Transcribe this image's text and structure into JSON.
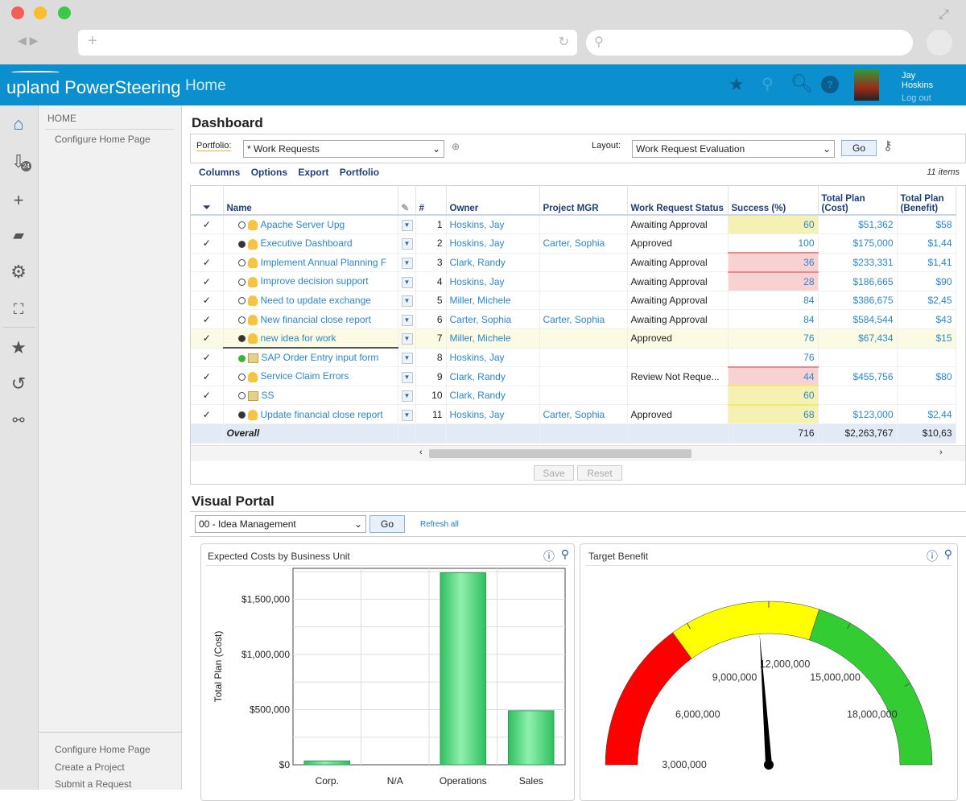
{
  "header": {
    "logo": "upland PowerSteering",
    "page": "Home",
    "user_first": "Jay",
    "user_last": "Hoskins",
    "logout": "Log out"
  },
  "colors": {
    "header": "#0b8fcf",
    "link": "#2a87cf",
    "gauge_red": "#ff0000",
    "gauge_yellow": "#ffff00",
    "gauge_green": "#33cc33",
    "bar": "#3fcf6f"
  },
  "rail": [
    {
      "icon": "home-icon"
    },
    {
      "icon": "inbox-download-icon",
      "badge": "24"
    },
    {
      "icon": "plus-icon"
    },
    {
      "icon": "folder-search-icon"
    },
    {
      "icon": "gear-icon"
    },
    {
      "icon": "chart-icon"
    },
    {
      "icon": "star-icon"
    },
    {
      "icon": "history-icon"
    },
    {
      "icon": "link-icon"
    }
  ],
  "sidebar": {
    "section": "HOME",
    "items": [
      "Configure Home Page"
    ],
    "bottom": [
      "Configure Home Page",
      "Create a Project",
      "Submit a Request"
    ]
  },
  "dashboard": {
    "title": "Dashboard",
    "portfolio_label": "Portfolio:",
    "portfolio_value": "* Work Requests",
    "layout_label": "Layout:",
    "layout_value": "Work Request Evaluation",
    "go": "Go",
    "links": [
      "Columns",
      "Options",
      "Export",
      "Portfolio"
    ],
    "count": "11 items",
    "columns": [
      "Name",
      "#",
      "Owner",
      "Project MGR",
      "Work Request Status",
      "Success (%)",
      "Total Plan (Cost)",
      "Total Plan (Benefit)"
    ],
    "rows": [
      {
        "check": "✓",
        "state": "open",
        "icon": "bulb",
        "name": "Apache Server Upg",
        "num": "1",
        "owner": "Hoskins, Jay",
        "mgr": "",
        "status": "Awaiting Approval",
        "success": "60",
        "flag": "yel",
        "cost": "$51,362",
        "benefit": "$58"
      },
      {
        "check": "✓",
        "state": "filled",
        "icon": "bulb",
        "name": "Executive Dashboard",
        "num": "2",
        "owner": "Hoskins, Jay",
        "mgr": "Carter, Sophia",
        "status": "Approved",
        "success": "100",
        "flag": "",
        "cost": "$175,000",
        "benefit": "$1,44"
      },
      {
        "check": "✓",
        "state": "open",
        "icon": "bulb",
        "name": "Implement Annual Planning F",
        "num": "3",
        "owner": "Clark, Randy",
        "mgr": "",
        "status": "Awaiting Approval",
        "success": "36",
        "flag": "red",
        "cost": "$233,331",
        "benefit": "$1,41"
      },
      {
        "check": "✓",
        "state": "open",
        "icon": "bulb",
        "name": "Improve decision support",
        "num": "4",
        "owner": "Hoskins, Jay",
        "mgr": "",
        "status": "Awaiting Approval",
        "success": "28",
        "flag": "red",
        "cost": "$186,665",
        "benefit": "$90"
      },
      {
        "check": "✓",
        "state": "open",
        "icon": "bulb",
        "name": "Need to update exchange",
        "num": "5",
        "owner": "Miller, Michele",
        "mgr": "",
        "status": "Awaiting Approval",
        "success": "84",
        "flag": "",
        "cost": "$386,675",
        "benefit": "$2,45"
      },
      {
        "check": "✓",
        "state": "open",
        "icon": "bulb",
        "name": "New financial close report",
        "num": "6",
        "owner": "Carter, Sophia",
        "mgr": "Carter, Sophia",
        "status": "Awaiting Approval",
        "success": "84",
        "flag": "",
        "cost": "$584,544",
        "benefit": "$43"
      },
      {
        "check": "✓",
        "state": "filled",
        "icon": "bulb",
        "name": "new idea for work",
        "num": "7",
        "owner": "Miller, Michele",
        "mgr": "",
        "status": "Approved",
        "success": "76",
        "flag": "",
        "cost": "$67,434",
        "benefit": "$15"
      },
      {
        "check": "✓",
        "state": "green",
        "icon": "book",
        "name": "SAP Order Entry input form",
        "num": "8",
        "owner": "Hoskins, Jay",
        "mgr": "",
        "status": "",
        "success": "76",
        "flag": "",
        "cost": "",
        "benefit": ""
      },
      {
        "check": "✓",
        "state": "open",
        "icon": "bulb",
        "name": "Service Claim Errors",
        "num": "9",
        "owner": "Clark, Randy",
        "mgr": "",
        "status": "Review Not Reque...",
        "success": "44",
        "flag": "red",
        "cost": "$455,756",
        "benefit": "$80"
      },
      {
        "check": "✓",
        "state": "open",
        "icon": "book",
        "name": "SS",
        "num": "10",
        "owner": "Clark, Randy",
        "mgr": "",
        "status": "",
        "success": "60",
        "flag": "yel",
        "cost": "",
        "benefit": ""
      },
      {
        "check": "✓",
        "state": "filled",
        "icon": "bulb",
        "name": "Update financial close report",
        "num": "11",
        "owner": "Hoskins, Jay",
        "mgr": "Carter, Sophia",
        "status": "Approved",
        "success": "68",
        "flag": "yel",
        "cost": "$123,000",
        "benefit": "$2,44"
      }
    ],
    "overall": {
      "label": "Overall",
      "success": "716",
      "cost": "$2,263,767",
      "benefit": "$10,63"
    },
    "save": "Save",
    "reset": "Reset"
  },
  "portal": {
    "title": "Visual Portal",
    "select": "00 - Idea Management",
    "go": "Go",
    "refresh": "Refresh all"
  },
  "chart_data": [
    {
      "type": "bar",
      "title": "Expected Costs by Business Unit",
      "ylabel": "Total Plan (Cost)",
      "xlabel": "",
      "categories": [
        "Corp.",
        "N/A",
        "Operations",
        "Sales"
      ],
      "values": [
        35000,
        0,
        1740000,
        490000
      ],
      "ylim": [
        0,
        1780000
      ],
      "yticks": [
        "$0",
        "$500,000",
        "$1,000,000",
        "$1,500,000"
      ],
      "grid": true
    },
    {
      "type": "gauge",
      "title": "Target Benefit",
      "range": [
        3000000,
        21000000
      ],
      "ticks": [
        "3,000,000",
        "6,000,000",
        "9,000,000",
        "12,000,000",
        "15,000,000",
        "18,000,000"
      ],
      "bands": [
        {
          "from": 3000000,
          "to": 8400000,
          "color": "red"
        },
        {
          "from": 8400000,
          "to": 13800000,
          "color": "yellow"
        },
        {
          "from": 13800000,
          "to": 21000000,
          "color": "green"
        }
      ],
      "value": 11600000
    }
  ]
}
